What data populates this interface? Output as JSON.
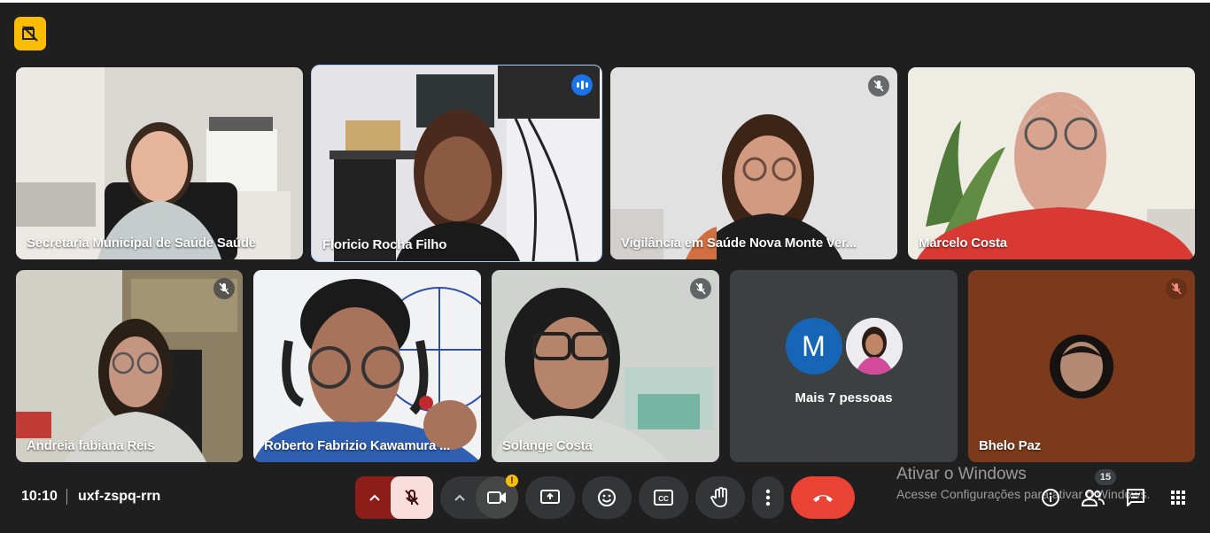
{
  "meeting": {
    "time": "10:10",
    "code": "uxf-zspq-rrn"
  },
  "tiles": [
    {
      "name": "Secretaria Municipal de Saúde Saúde"
    },
    {
      "name": "Floricio Rocha Filho"
    },
    {
      "name": "Vigilância em Saúde Nova Monte Ver..."
    },
    {
      "name": "Marcelo Costa"
    },
    {
      "name": "Andreia fabiana Reis"
    },
    {
      "name": "Roberto Fabrizio Kawamura ..."
    },
    {
      "name": "Solange Costa"
    },
    {
      "name": "Bhelo Paz"
    }
  ],
  "others": {
    "label": "Mais 7 pessoas",
    "avatar_letter": "M"
  },
  "activation": {
    "title": "Ativar o Windows",
    "subtitle": "Acesse Configurações para ativar o Windows."
  },
  "participants_count": "15",
  "icons": [
    "no-recording-icon",
    "mic-off-icon",
    "camera-icon",
    "present-icon",
    "emoji-icon",
    "captions-icon",
    "raise-hand-icon",
    "more-vert-icon",
    "end-call-icon",
    "info-icon",
    "people-icon",
    "chat-icon",
    "apps-icon"
  ],
  "colors": {
    "background": "#1f1f1f",
    "end_call": "#ea4335",
    "mic_active_bg": "#f9dedc",
    "speaking": "#1a73e8",
    "badge": "#fbbc04",
    "avatar_m": "#1765b7"
  }
}
